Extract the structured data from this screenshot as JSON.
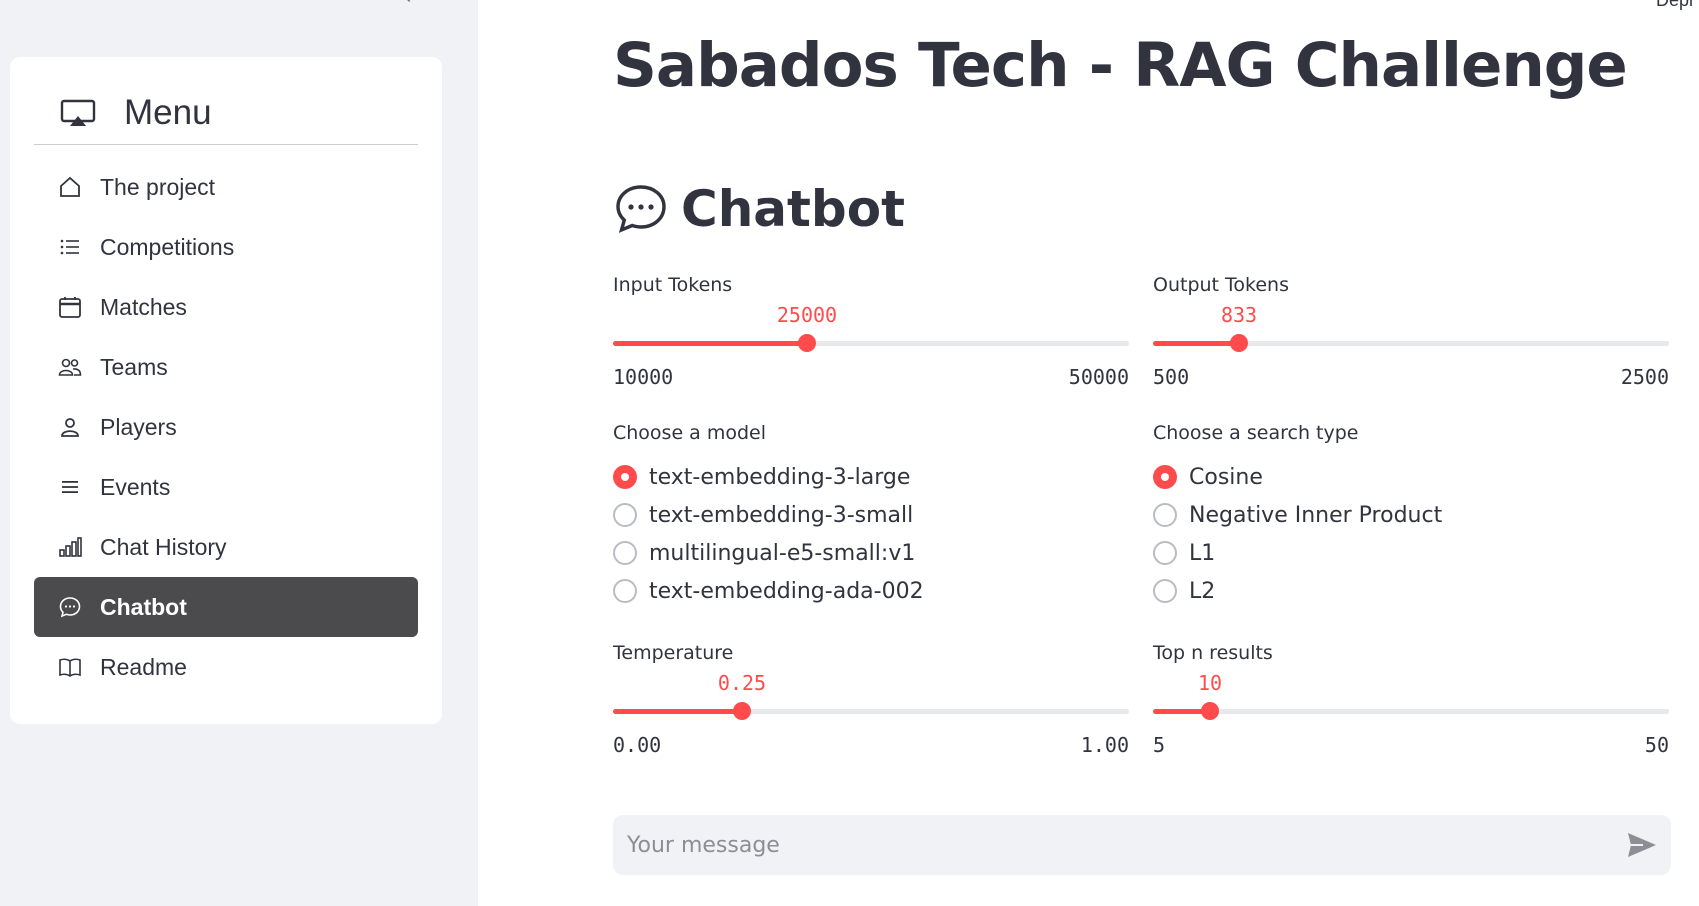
{
  "sidebar": {
    "menu_title": "Menu",
    "items": [
      {
        "label": "The project",
        "icon": "house-icon"
      },
      {
        "label": "Competitions",
        "icon": "list-icon"
      },
      {
        "label": "Matches",
        "icon": "calendar-icon"
      },
      {
        "label": "Teams",
        "icon": "people-icon"
      },
      {
        "label": "Players",
        "icon": "person-icon"
      },
      {
        "label": "Events",
        "icon": "hamburger-list-icon"
      },
      {
        "label": "Chat History",
        "icon": "bar-chart-icon"
      },
      {
        "label": "Chatbot",
        "icon": "chat-dots-icon",
        "active": true
      },
      {
        "label": "Readme",
        "icon": "book-icon"
      }
    ]
  },
  "main": {
    "deploy_label": "Depl",
    "page_title": "Sabados Tech - RAG Challenge",
    "section_title": "Chatbot",
    "input_tokens": {
      "label": "Input Tokens",
      "value": "25000",
      "min": "10000",
      "max": "50000",
      "fraction": 0.375
    },
    "output_tokens": {
      "label": "Output Tokens",
      "value": "833",
      "min": "500",
      "max": "2500",
      "fraction": 0.1665
    },
    "model": {
      "label": "Choose a model",
      "options": [
        "text-embedding-3-large",
        "text-embedding-3-small",
        "multilingual-e5-small:v1",
        "text-embedding-ada-002"
      ],
      "selected_index": 0
    },
    "search_type": {
      "label": "Choose a search type",
      "options": [
        "Cosine",
        "Negative Inner Product",
        "L1",
        "L2"
      ],
      "selected_index": 0
    },
    "temperature": {
      "label": "Temperature",
      "value": "0.25",
      "min": "0.00",
      "max": "1.00",
      "fraction": 0.25
    },
    "top_n": {
      "label": "Top n results",
      "value": "10",
      "min": "5",
      "max": "50",
      "fraction": 0.111
    },
    "chat_input": {
      "placeholder": "Your message"
    }
  },
  "colors": {
    "accent": "#ff4b4b",
    "sidebar_bg": "#f0f2f6",
    "active_item_bg": "#4b4b4d",
    "text": "#31333f"
  }
}
